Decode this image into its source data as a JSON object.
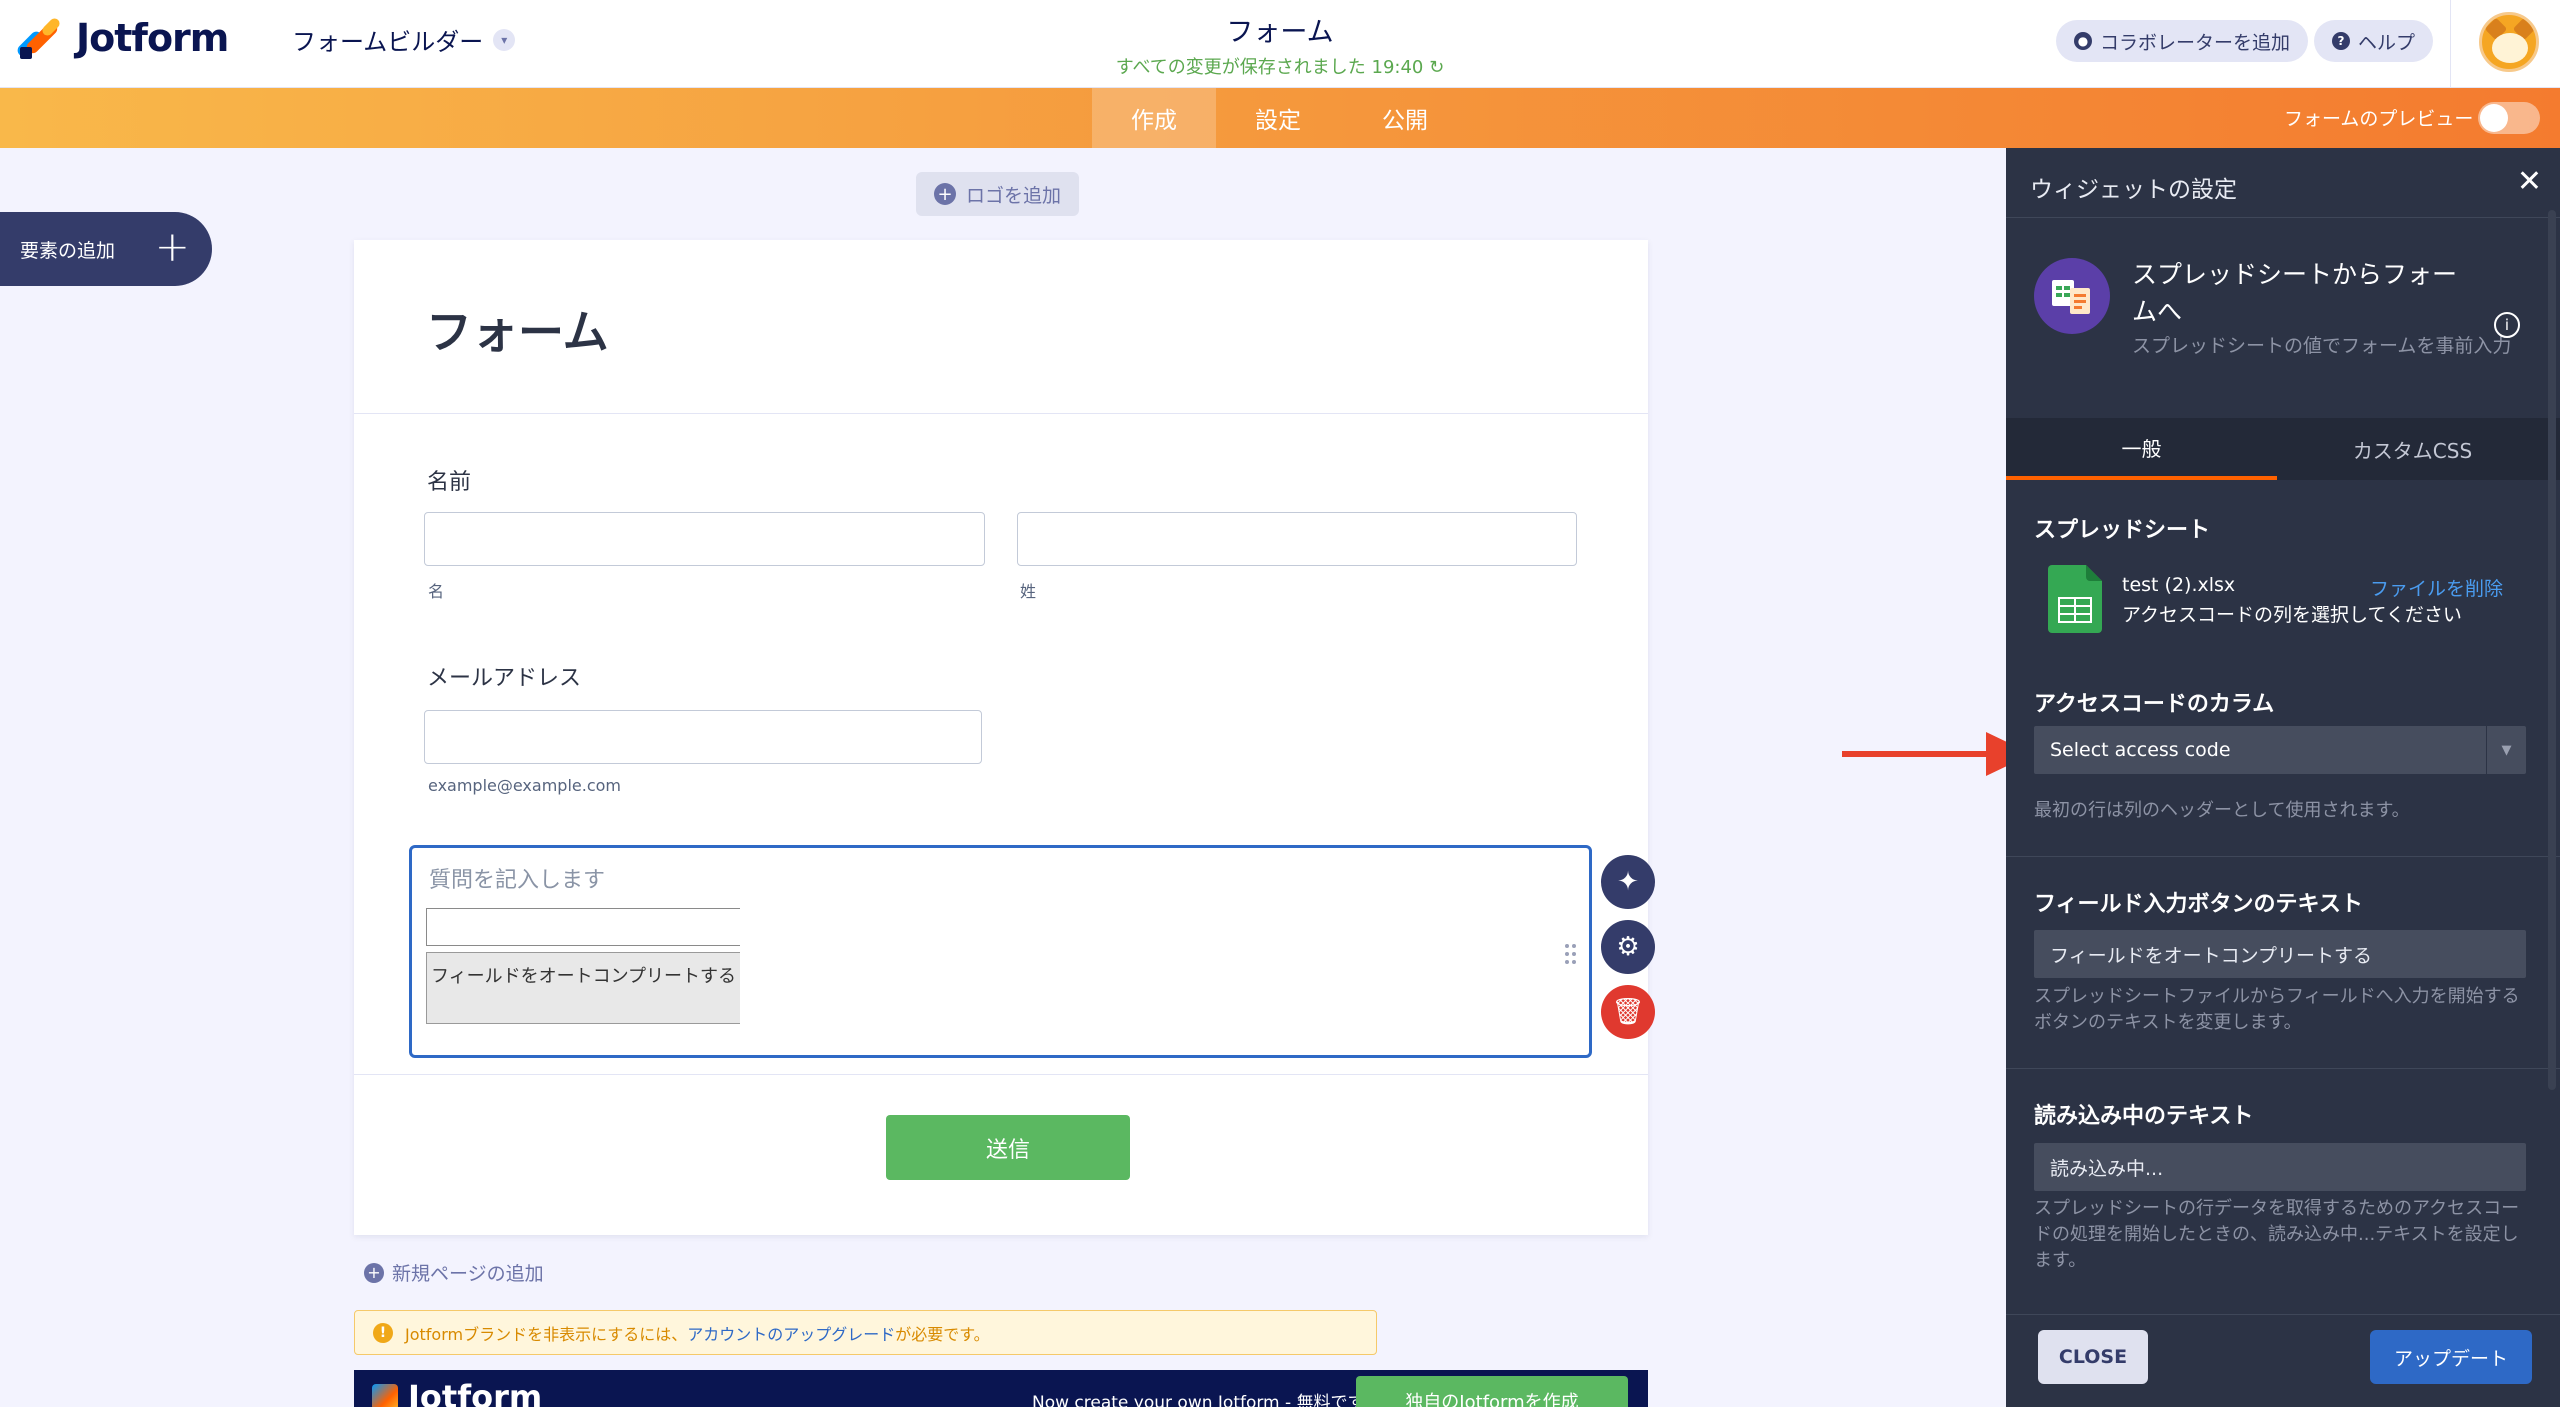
{
  "app": {
    "logo_text": "Jotform",
    "builder_menu": "フォームビルダー",
    "form_title": "フォーム",
    "saved_status": "すべての変更が保存されました 19:40",
    "add_collaborator": "コラボレーターを追加",
    "help": "ヘルプ"
  },
  "nav": {
    "tabs": [
      {
        "label": "作成",
        "active": true
      },
      {
        "label": "設定",
        "active": false
      },
      {
        "label": "公開",
        "active": false
      }
    ],
    "preview_label": "フォームのプレビュー"
  },
  "builder": {
    "add_element": "要素の追加",
    "add_logo": "ロゴを追加",
    "form_heading": "フォーム",
    "name_label": "名前",
    "first_sub": "名",
    "last_sub": "姓",
    "email_label": "メールアドレス",
    "email_sub": "example@example.com",
    "question_placeholder": "質問を記入します",
    "autocomplete_button": "フィールドをオートコンプリートする",
    "submit": "送信",
    "new_page": "新規ページの追加",
    "notice_prefix": "Jotformブランドを非表示にするには、",
    "notice_link": "アカウントのアップグレード",
    "notice_suffix": "が必要です。",
    "footer_logo": "Jotform",
    "footer_text": "Now create your own Jotform - 無料です",
    "footer_button": "独自のJotformを作成"
  },
  "panel": {
    "title": "ウィジェットの設定",
    "widget_name": "スプレッドシートからフォームへ",
    "widget_desc": "スプレッドシートの値でフォームを事前入力",
    "tabs": [
      "一般",
      "カスタムCSS"
    ],
    "spreadsheet_title": "スプレッドシート",
    "file_name": "test (2).xlsx",
    "file_delete": "ファイルを削除",
    "file_hint": "アクセスコードの列を選択してください",
    "access_code_title": "アクセスコードのカラム",
    "access_code_select": "Select access code",
    "access_code_help": "最初の行は列のヘッダーとして使用されます。",
    "button_text_title": "フィールド入力ボタンのテキスト",
    "button_text_value": "フィールドをオートコンプリートする",
    "button_text_help": "スプレッドシートファイルからフィールドへ入力を開始するボタンのテキストを変更します。",
    "loading_title": "読み込み中のテキスト",
    "loading_value": "読み込み中...",
    "loading_help": "スプレッドシートの行データを取得するためのアクセスコードの処理を開始したときの、読み込み中...テキストを設定します。",
    "close": "CLOSE",
    "update": "アップデート"
  },
  "colors": {
    "accent_orange": "#f47b2f",
    "panel_bg": "#2c3345",
    "submit_green": "#5bb861",
    "primary_blue": "#2e69c6",
    "annotation_red": "#e8412c"
  }
}
